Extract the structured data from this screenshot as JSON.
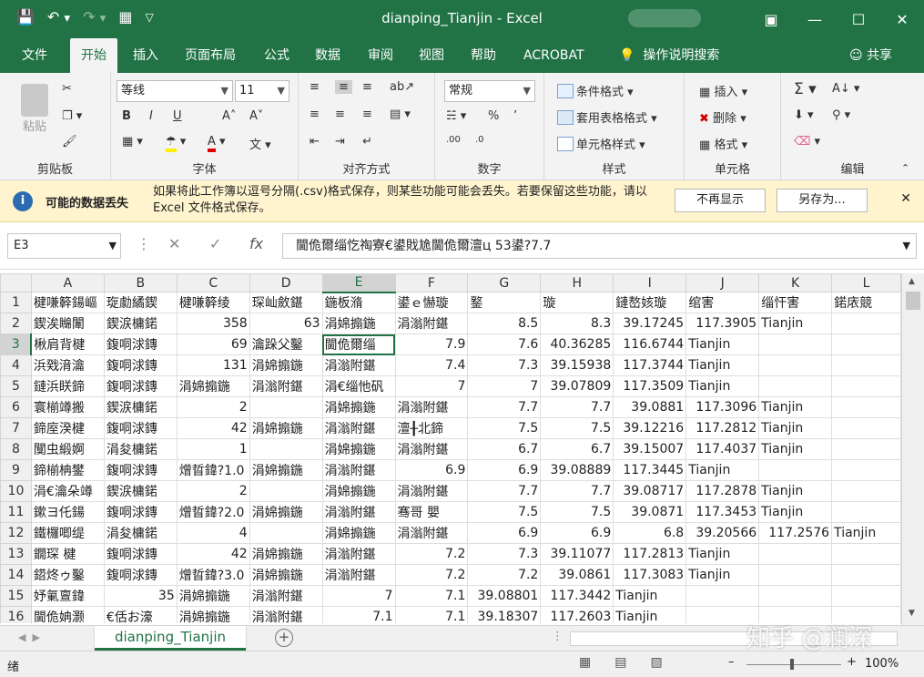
{
  "window": {
    "title": "dianping_Tianjin  -  Excel",
    "accent": "#217346"
  },
  "tabs": [
    "文件",
    "开始",
    "插入",
    "页面布局",
    "公式",
    "数据",
    "审阅",
    "视图",
    "帮助",
    "ACROBAT"
  ],
  "active_tab": "开始",
  "tell_me": "操作说明搜索",
  "share": "共享",
  "ribbon": {
    "clipboard": {
      "label": "剪贴板",
      "paste": "粘贴"
    },
    "font": {
      "label": "字体",
      "font_name": "等线",
      "font_size": "11",
      "bold": "B",
      "italic": "I",
      "underline": "U"
    },
    "alignment": {
      "label": "对齐方式"
    },
    "number": {
      "label": "数字",
      "format": "常规"
    },
    "styles": {
      "label": "样式",
      "conditional": "条件格式",
      "table": "套用表格格式",
      "cell_styles": "单元格样式"
    },
    "cells": {
      "label": "单元格",
      "insert": "插入",
      "delete": "删除",
      "format": "格式"
    },
    "editing": {
      "label": "编辑"
    }
  },
  "message_bar": {
    "title": "可能的数据丢失",
    "text": "如果将此工作簿以逗号分隔(.csv)格式保存，则某些功能可能会丢失。若要保留这些功能，请以 Excel 文件格式保存。",
    "btn_dismiss": "不再显示",
    "btn_saveas": "另存为..."
  },
  "formula_bar": {
    "name_box": "E3",
    "formula": "閫佹爾缁忔祹寮€鍙戝尯閫佹爾澶ц   53鍙?7.7"
  },
  "columns": [
    "A",
    "B",
    "C",
    "D",
    "E",
    "F",
    "G",
    "H",
    "I",
    "J",
    "K",
    "L"
  ],
  "selected_column": "E",
  "selected_row": "3",
  "rows": [
    {
      "n": "1",
      "cells": [
        "楗嗛簳鍚嶇",
        "琁勮繘鍥",
        "楗嗛簳绫",
        "琛屾斂鍖",
        "鍦板潃",
        "鍙ｅ懗璇",
        "鐜",
        "璇",
        "鏈嶅姟璇",
        "绾害",
        "缁忓害",
        "鍩庡競"
      ]
    },
    {
      "n": "2",
      "cells": [
        "鍥涘矊闈",
        "鍥涙槦鍩",
        "358",
        "63",
        "涓婂搧鍦",
        "涓滃附鍖",
        "8.5",
        "8.3",
        "39.17245",
        "117.3905",
        "Tianjin",
        ""
      ]
    },
    {
      "n": "3",
      "cells": [
        "楸肩背楗",
        "鍑哃浗鏄",
        "69",
        "瀹跺父鑿",
        "閫佹爾缁",
        "7.9",
        "7.6",
        "40.36285",
        "116.6744",
        "Tianjin",
        "",
        ""
      ]
    },
    {
      "n": "4",
      "cells": [
        "浜戣湇瀹",
        "鍑哃浗鏄",
        "131",
        "涓婂搧鍦",
        "涓滃附鍖",
        "7.4",
        "7.3",
        "39.15938",
        "117.3744",
        "Tianjin",
        "",
        ""
      ]
    },
    {
      "n": "5",
      "cells": [
        "鏈浜眹鍗",
        "鍑哃浗鏄",
        "涓婂搧鍦",
        "涓滃附鍖",
        "涓€缁忚矾",
        "7",
        "7",
        "39.07809",
        "117.3509",
        "Tianjin",
        "",
        ""
      ]
    },
    {
      "n": "6",
      "cells": [
        "寰椾竴搬",
        "鍥涙槦鍩",
        "2",
        "",
        "涓婂搧鍦",
        "涓滃附鍖",
        "7.7",
        "7.7",
        "39.0881",
        "117.3096",
        "Tianjin",
        ""
      ]
    },
    {
      "n": "7",
      "cells": [
        "鍗庢湀楗",
        "鍑哃浗鏄",
        "42",
        "涓婂搧鍦",
        "涓滃附鍖",
        "澶╂北鍗",
        "7.5",
        "7.5",
        "39.12216",
        "117.2812",
        "Tianjin",
        ""
      ]
    },
    {
      "n": "8",
      "cells": [
        "闃虫緞婀",
        "涓夋槦鍩",
        "1",
        "",
        "涓婂搧鍦",
        "涓滃附鍖",
        "6.7",
        "6.7",
        "39.15007",
        "117.4037",
        "Tianjin",
        ""
      ]
    },
    {
      "n": "9",
      "cells": [
        "鍗椾柟鐢",
        "鍑哃浗鏄",
        "熷晢鍏?1.0",
        "涓婂搧鍦",
        "涓滃附鍖",
        "6.9",
        "6.9",
        "39.08889",
        "117.3445",
        "Tianjin",
        "",
        ""
      ]
    },
    {
      "n": "10",
      "cells": [
        "涓€瀹朵竴",
        "鍥涙槦鍩",
        "2",
        "",
        "涓婂搧鍦",
        "涓滃附鍖",
        "7.7",
        "7.7",
        "39.08717",
        "117.2878",
        "Tianjin",
        ""
      ]
    },
    {
      "n": "11",
      "cells": [
        "鏉ヨ仛鍚",
        "鍑哃浗鏄",
        "熷晢鍏?2.0",
        "涓婂搧鍦",
        "涓滃附鍖",
        "骞哥  嬰",
        "7.5",
        "7.5",
        "39.0871",
        "117.3453",
        "Tianjin",
        ""
      ]
    },
    {
      "n": "12",
      "cells": [
        "鐵欏唧缇",
        "涓夋槦鍩",
        "4",
        "",
        "涓婂搧鍦",
        "涓滃附鍖",
        "6.9",
        "6.9",
        "6.8",
        "39.20566",
        "117.2576",
        "Tianjin"
      ]
    },
    {
      "n": "13",
      "cells": [
        "鐗琛   楗",
        "鍑哃浗鏄",
        "42",
        "涓婂搧鍦",
        "涓滃附鍖",
        "7.2",
        "7.3",
        "39.11077",
        "117.2813",
        "Tianjin",
        "",
        ""
      ]
    },
    {
      "n": "14",
      "cells": [
        "鍣炵ゥ鑿",
        "鍑哃浗鏄",
        "熷晢鍏?3.0",
        "涓婂搧鍦",
        "涓滃附鍖",
        "7.2",
        "7.2",
        "39.0861",
        "117.3083",
        "Tianjin",
        "",
        ""
      ]
    },
    {
      "n": "15",
      "cells": [
        "妤氭亶鍏",
        "35",
        "涓婂搧鍦",
        "涓滃附鍖",
        "7",
        "7.1",
        "39.08801",
        "117.3442",
        "Tianjin",
        "",
        "",
        ""
      ]
    },
    {
      "n": "16",
      "cells": [
        "閫佹姌灏",
        "€佸お濠",
        "涓婂搧鍦",
        "涓滃附鍖",
        "7.1",
        "7.1",
        "39.18307",
        "117.2603",
        "Tianjin",
        "",
        "",
        ""
      ]
    }
  ],
  "sheet_tab": "dianping_Tianjin",
  "status": {
    "ready": "绪",
    "zoom": "100%"
  },
  "watermark": "知乎 @澜深"
}
